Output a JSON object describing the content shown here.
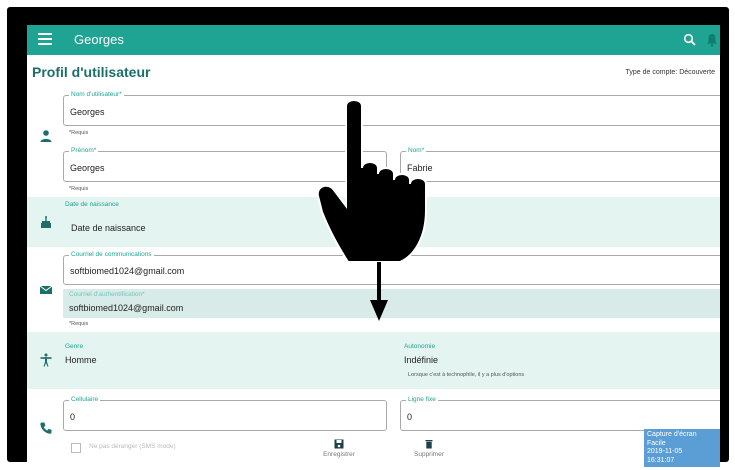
{
  "appbar": {
    "title": "Georges",
    "menu_icon": "menu-icon",
    "search_icon": "search-icon",
    "bell_icon": "bell-icon"
  },
  "page": {
    "title": "Profil d'utilisateur",
    "account_type": "Type de compte: Découverte"
  },
  "username": {
    "label": "Nom d'utilisateur*",
    "value": "Georges",
    "helper": "*Requis"
  },
  "firstname": {
    "label": "Prénom*",
    "value": "Georges",
    "helper": "*Requis"
  },
  "lastname": {
    "label": "Nom*",
    "value": "Fabrie"
  },
  "birthdate": {
    "label": "Date de naissance",
    "value": "Date de naissance"
  },
  "comm_email": {
    "label": "Courriel de communications",
    "value": "softbiomed1024@gmail.com"
  },
  "auth_email": {
    "label": "Courriel d'authentification*",
    "value": "softbiomed1024@gmail.com",
    "helper": "*Requis"
  },
  "gender": {
    "label": "Genre",
    "value": "Homme"
  },
  "autonomy": {
    "label": "Autonomie",
    "value": "Indéfinie",
    "helper": "Lorsque c'est à technophile, il y a plus d'options"
  },
  "mobile": {
    "label": "Cellulaire",
    "value": "0"
  },
  "landline": {
    "label": "Ligne fixe",
    "value": "0"
  },
  "bottom": {
    "checkbox_label": "Ne pas déranger (SMS mode)",
    "save_label": "Enregistrer",
    "delete_label": "Supprimer"
  },
  "capture_badge": {
    "title": "Capture d'écran Facile",
    "date": "2019-11-05",
    "time": "16:31:07"
  },
  "colors": {
    "accent": "#1fa392",
    "band": "#e3f4f1",
    "title": "#1c6f69"
  }
}
